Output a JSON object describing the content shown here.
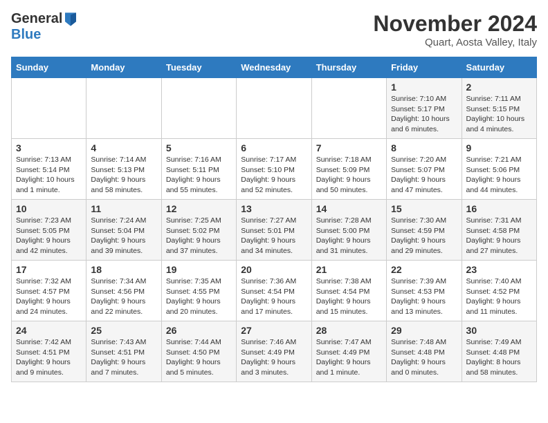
{
  "logo": {
    "general": "General",
    "blue": "Blue"
  },
  "title": "November 2024",
  "location": "Quart, Aosta Valley, Italy",
  "headers": [
    "Sunday",
    "Monday",
    "Tuesday",
    "Wednesday",
    "Thursday",
    "Friday",
    "Saturday"
  ],
  "weeks": [
    [
      {
        "day": "",
        "info": ""
      },
      {
        "day": "",
        "info": ""
      },
      {
        "day": "",
        "info": ""
      },
      {
        "day": "",
        "info": ""
      },
      {
        "day": "",
        "info": ""
      },
      {
        "day": "1",
        "info": "Sunrise: 7:10 AM\nSunset: 5:17 PM\nDaylight: 10 hours\nand 6 minutes."
      },
      {
        "day": "2",
        "info": "Sunrise: 7:11 AM\nSunset: 5:15 PM\nDaylight: 10 hours\nand 4 minutes."
      }
    ],
    [
      {
        "day": "3",
        "info": "Sunrise: 7:13 AM\nSunset: 5:14 PM\nDaylight: 10 hours\nand 1 minute."
      },
      {
        "day": "4",
        "info": "Sunrise: 7:14 AM\nSunset: 5:13 PM\nDaylight: 9 hours\nand 58 minutes."
      },
      {
        "day": "5",
        "info": "Sunrise: 7:16 AM\nSunset: 5:11 PM\nDaylight: 9 hours\nand 55 minutes."
      },
      {
        "day": "6",
        "info": "Sunrise: 7:17 AM\nSunset: 5:10 PM\nDaylight: 9 hours\nand 52 minutes."
      },
      {
        "day": "7",
        "info": "Sunrise: 7:18 AM\nSunset: 5:09 PM\nDaylight: 9 hours\nand 50 minutes."
      },
      {
        "day": "8",
        "info": "Sunrise: 7:20 AM\nSunset: 5:07 PM\nDaylight: 9 hours\nand 47 minutes."
      },
      {
        "day": "9",
        "info": "Sunrise: 7:21 AM\nSunset: 5:06 PM\nDaylight: 9 hours\nand 44 minutes."
      }
    ],
    [
      {
        "day": "10",
        "info": "Sunrise: 7:23 AM\nSunset: 5:05 PM\nDaylight: 9 hours\nand 42 minutes."
      },
      {
        "day": "11",
        "info": "Sunrise: 7:24 AM\nSunset: 5:04 PM\nDaylight: 9 hours\nand 39 minutes."
      },
      {
        "day": "12",
        "info": "Sunrise: 7:25 AM\nSunset: 5:02 PM\nDaylight: 9 hours\nand 37 minutes."
      },
      {
        "day": "13",
        "info": "Sunrise: 7:27 AM\nSunset: 5:01 PM\nDaylight: 9 hours\nand 34 minutes."
      },
      {
        "day": "14",
        "info": "Sunrise: 7:28 AM\nSunset: 5:00 PM\nDaylight: 9 hours\nand 31 minutes."
      },
      {
        "day": "15",
        "info": "Sunrise: 7:30 AM\nSunset: 4:59 PM\nDaylight: 9 hours\nand 29 minutes."
      },
      {
        "day": "16",
        "info": "Sunrise: 7:31 AM\nSunset: 4:58 PM\nDaylight: 9 hours\nand 27 minutes."
      }
    ],
    [
      {
        "day": "17",
        "info": "Sunrise: 7:32 AM\nSunset: 4:57 PM\nDaylight: 9 hours\nand 24 minutes."
      },
      {
        "day": "18",
        "info": "Sunrise: 7:34 AM\nSunset: 4:56 PM\nDaylight: 9 hours\nand 22 minutes."
      },
      {
        "day": "19",
        "info": "Sunrise: 7:35 AM\nSunset: 4:55 PM\nDaylight: 9 hours\nand 20 minutes."
      },
      {
        "day": "20",
        "info": "Sunrise: 7:36 AM\nSunset: 4:54 PM\nDaylight: 9 hours\nand 17 minutes."
      },
      {
        "day": "21",
        "info": "Sunrise: 7:38 AM\nSunset: 4:54 PM\nDaylight: 9 hours\nand 15 minutes."
      },
      {
        "day": "22",
        "info": "Sunrise: 7:39 AM\nSunset: 4:53 PM\nDaylight: 9 hours\nand 13 minutes."
      },
      {
        "day": "23",
        "info": "Sunrise: 7:40 AM\nSunset: 4:52 PM\nDaylight: 9 hours\nand 11 minutes."
      }
    ],
    [
      {
        "day": "24",
        "info": "Sunrise: 7:42 AM\nSunset: 4:51 PM\nDaylight: 9 hours\nand 9 minutes."
      },
      {
        "day": "25",
        "info": "Sunrise: 7:43 AM\nSunset: 4:51 PM\nDaylight: 9 hours\nand 7 minutes."
      },
      {
        "day": "26",
        "info": "Sunrise: 7:44 AM\nSunset: 4:50 PM\nDaylight: 9 hours\nand 5 minutes."
      },
      {
        "day": "27",
        "info": "Sunrise: 7:46 AM\nSunset: 4:49 PM\nDaylight: 9 hours\nand 3 minutes."
      },
      {
        "day": "28",
        "info": "Sunrise: 7:47 AM\nSunset: 4:49 PM\nDaylight: 9 hours\nand 1 minute."
      },
      {
        "day": "29",
        "info": "Sunrise: 7:48 AM\nSunset: 4:48 PM\nDaylight: 9 hours\nand 0 minutes."
      },
      {
        "day": "30",
        "info": "Sunrise: 7:49 AM\nSunset: 4:48 PM\nDaylight: 8 hours\nand 58 minutes."
      }
    ]
  ]
}
